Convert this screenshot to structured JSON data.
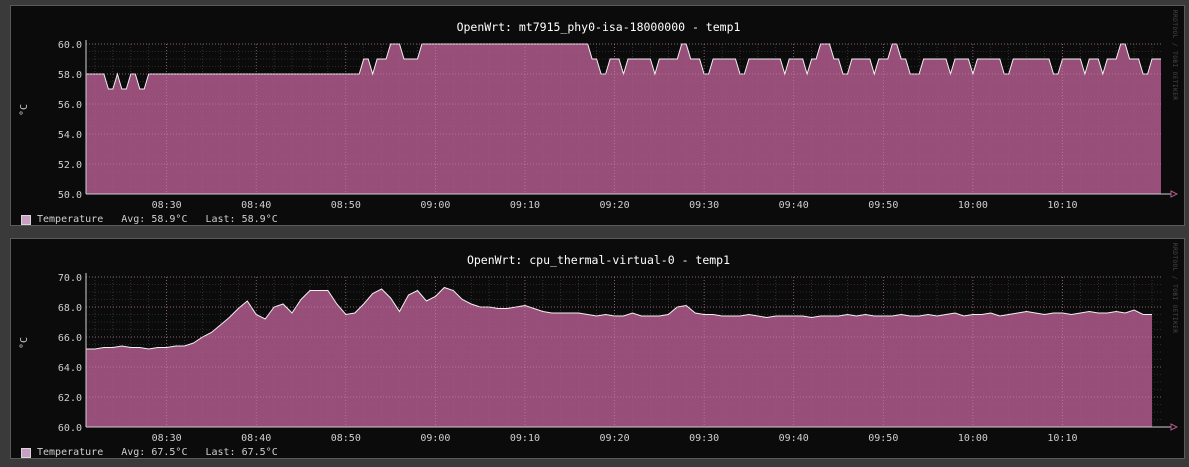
{
  "chart_data": [
    {
      "type": "area",
      "title": "OpenWrt: mt7915_phy0-isa-18000000 - temp1",
      "ylabel": "°C",
      "ylim": [
        50,
        60
      ],
      "y_ticks": [
        "50.0",
        "52.0",
        "54.0",
        "56.0",
        "58.0",
        "60.0"
      ],
      "x_ticks": [
        "08:30",
        "08:40",
        "08:50",
        "09:00",
        "09:10",
        "09:20",
        "09:30",
        "09:40",
        "09:50",
        "10:00",
        "10:10"
      ],
      "x_start": "08:21",
      "x_end": "10:21",
      "grid": true,
      "legend": {
        "label": "Temperature",
        "avg": "Avg: 58.9°C",
        "last": "Last: 58.9°C",
        "position": "bottom-left"
      },
      "watermark": "RRDTOOL / TOBI OETIKER",
      "series": [
        {
          "name": "Temperature",
          "color": "#b05a8c",
          "time_step_min": 0.5,
          "values": [
            58,
            58,
            58,
            58,
            58,
            57,
            57,
            58,
            57,
            57,
            58,
            58,
            57,
            57,
            58,
            58,
            58,
            58,
            58,
            58,
            58,
            58,
            58,
            58,
            58,
            58,
            58,
            58,
            58,
            58,
            58,
            58,
            58,
            58,
            58,
            58,
            58,
            58,
            58,
            58,
            58,
            58,
            58,
            58,
            58,
            58,
            58,
            58,
            58,
            58,
            58,
            58,
            58,
            58,
            58,
            58,
            58,
            58,
            58,
            58,
            58,
            58,
            59,
            59,
            58,
            59,
            59,
            59,
            60,
            60,
            60,
            59,
            59,
            59,
            59,
            60,
            60,
            60,
            60,
            60,
            60,
            60,
            60,
            60,
            60,
            60,
            60,
            60,
            60,
            60,
            60,
            60,
            60,
            60,
            60,
            60,
            60,
            60,
            60,
            60,
            60,
            60,
            60,
            60,
            60,
            60,
            60,
            60,
            60,
            60,
            60,
            60,
            60,
            59,
            59,
            58,
            58,
            59,
            59,
            59,
            58,
            59,
            59,
            59,
            59,
            59,
            59,
            58,
            59,
            59,
            59,
            59,
            59,
            60,
            60,
            59,
            59,
            59,
            58,
            58,
            59,
            59,
            59,
            59,
            59,
            59,
            58,
            58,
            59,
            59,
            59,
            59,
            59,
            59,
            59,
            59,
            58,
            59,
            59,
            59,
            59,
            58,
            59,
            59,
            60,
            60,
            60,
            59,
            59,
            58,
            58,
            59,
            59,
            59,
            59,
            59,
            58,
            59,
            59,
            59,
            60,
            60,
            59,
            59,
            58,
            58,
            58,
            59,
            59,
            59,
            59,
            59,
            59,
            58,
            59,
            59,
            59,
            59,
            58,
            59,
            59,
            59,
            59,
            59,
            59,
            58,
            58,
            59,
            59,
            59,
            59,
            59,
            59,
            59,
            59,
            59,
            58,
            58,
            59,
            59,
            59,
            59,
            59,
            58,
            59,
            59,
            59,
            58,
            59,
            59,
            59,
            60,
            60,
            59,
            59,
            59,
            58,
            58,
            59,
            59,
            59,
            59,
            59,
            58,
            59,
            59,
            59,
            60,
            60,
            59,
            58,
            58,
            59,
            59,
            59,
            59,
            59,
            59,
            58,
            58,
            59,
            59,
            59,
            59,
            59,
            58,
            59,
            59,
            60,
            60,
            60,
            59,
            59,
            59,
            58,
            58,
            59,
            59,
            59,
            59,
            59,
            59,
            58,
            59,
            59,
            59,
            59,
            59,
            58,
            58,
            59,
            59,
            60,
            60,
            60,
            59,
            59,
            59,
            58,
            58,
            58,
            59,
            59,
            59,
            59,
            59,
            59,
            58,
            59,
            59,
            59,
            59,
            59,
            60,
            60,
            60,
            60,
            60,
            60,
            60,
            60,
            59,
            59,
            58,
            58,
            59,
            59,
            59,
            59,
            58,
            59,
            59,
            59,
            58,
            58,
            59,
            59,
            59,
            59,
            59,
            59,
            60,
            60,
            60,
            60,
            60,
            60,
            60,
            60,
            60,
            60,
            59,
            59,
            58,
            58,
            59,
            59,
            59,
            59,
            59,
            58,
            59,
            59,
            59,
            59,
            59,
            59,
            58,
            59,
            59,
            59,
            59,
            59,
            58,
            58,
            59,
            59,
            60,
            60,
            59,
            59,
            58,
            58,
            59,
            59,
            60,
            60,
            59,
            58,
            59
          ]
        }
      ]
    },
    {
      "type": "area",
      "title": "OpenWrt: cpu_thermal-virtual-0 - temp1",
      "ylabel": "°C",
      "ylim": [
        60,
        70
      ],
      "y_ticks": [
        "60.0",
        "62.0",
        "64.0",
        "66.0",
        "68.0",
        "70.0"
      ],
      "x_ticks": [
        "08:30",
        "08:40",
        "08:50",
        "09:00",
        "09:10",
        "09:20",
        "09:30",
        "09:40",
        "09:50",
        "10:00",
        "10:10"
      ],
      "x_start": "08:21",
      "x_end": "10:21",
      "grid": true,
      "legend": {
        "label": "Temperature",
        "avg": "Avg: 67.5°C",
        "last": "Last: 67.5°C",
        "position": "bottom-left"
      },
      "watermark": "RRDTOOL / TOBI OETIKER",
      "series": [
        {
          "name": "Temperature",
          "color": "#b05a8c",
          "time_step_min": 1,
          "values": [
            65.2,
            65.2,
            65.3,
            65.3,
            65.4,
            65.3,
            65.3,
            65.2,
            65.3,
            65.3,
            65.4,
            65.4,
            65.6,
            66,
            66.3,
            66.8,
            67.3,
            67.9,
            68.4,
            67.5,
            67.2,
            68,
            68.2,
            67.6,
            68.5,
            69.1,
            69.1,
            69.1,
            68.2,
            67.5,
            67.6,
            68.2,
            68.9,
            69.2,
            68.6,
            67.7,
            68.8,
            69.1,
            68.4,
            68.7,
            69.3,
            69.1,
            68.5,
            68.2,
            68,
            68,
            67.9,
            67.9,
            68,
            68.1,
            67.9,
            67.7,
            67.6,
            67.6,
            67.6,
            67.6,
            67.5,
            67.4,
            67.5,
            67.4,
            67.4,
            67.6,
            67.4,
            67.4,
            67.4,
            67.5,
            68,
            68.1,
            67.6,
            67.5,
            67.5,
            67.4,
            67.4,
            67.4,
            67.5,
            67.4,
            67.3,
            67.4,
            67.4,
            67.4,
            67.4,
            67.3,
            67.4,
            67.4,
            67.4,
            67.5,
            67.4,
            67.5,
            67.4,
            67.4,
            67.4,
            67.5,
            67.4,
            67.4,
            67.5,
            67.4,
            67.5,
            67.6,
            67.4,
            67.5,
            67.5,
            67.6,
            67.4,
            67.5,
            67.6,
            67.7,
            67.6,
            67.5,
            67.6,
            67.6,
            67.5,
            67.6,
            67.7,
            67.6,
            67.6,
            67.7,
            67.6,
            67.8,
            67.5,
            67.5
          ]
        }
      ]
    }
  ]
}
